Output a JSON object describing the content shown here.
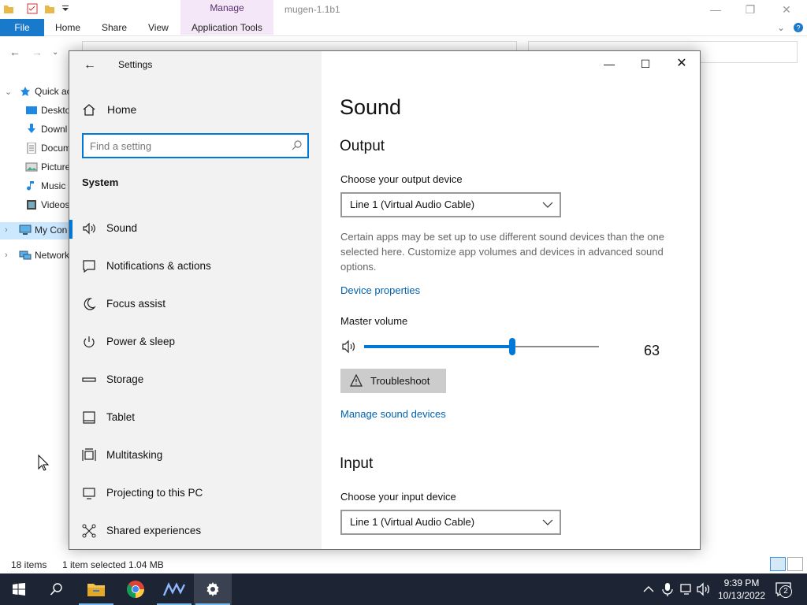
{
  "explorer": {
    "manage_tab": "Manage",
    "window_title": "mugen-1.1b1",
    "ribbon_tabs": {
      "file": "File",
      "home": "Home",
      "share": "Share",
      "view": "View",
      "app_tools": "Application Tools"
    },
    "tree": {
      "quick_access": "Quick ac",
      "desktop": "Deskto",
      "downloads": "Downl",
      "documents": "Docum",
      "pictures": "Picture",
      "music": "Music",
      "videos": "Videos",
      "my_computer": "My Con",
      "network": "Network"
    },
    "status": {
      "items": "18 items",
      "selected": "1 item selected  1.04 MB"
    }
  },
  "settings": {
    "title": "Settings",
    "home": "Home",
    "search_placeholder": "Find a setting",
    "category": "System",
    "nav": [
      {
        "label": "Sound",
        "icon": "speaker-icon",
        "active": true
      },
      {
        "label": "Notifications & actions",
        "icon": "notification-icon"
      },
      {
        "label": "Focus assist",
        "icon": "moon-icon"
      },
      {
        "label": "Power & sleep",
        "icon": "power-icon"
      },
      {
        "label": "Storage",
        "icon": "storage-icon"
      },
      {
        "label": "Tablet",
        "icon": "tablet-icon"
      },
      {
        "label": "Multitasking",
        "icon": "multitasking-icon"
      },
      {
        "label": "Projecting to this PC",
        "icon": "projector-icon"
      },
      {
        "label": "Shared experiences",
        "icon": "shared-icon"
      }
    ],
    "page": {
      "heading": "Sound",
      "output_heading": "Output",
      "output_device_label": "Choose your output device",
      "output_device_value": "Line 1 (Virtual Audio Cable)",
      "description": "Certain apps may be set up to use different sound devices than the one selected here. Customize app volumes and devices in advanced sound options.",
      "device_properties": "Device properties",
      "master_volume_label": "Master volume",
      "master_volume_value": "63",
      "master_volume_level": 0.63,
      "troubleshoot": "Troubleshoot",
      "manage_devices": "Manage sound devices",
      "input_heading": "Input",
      "input_device_label": "Choose your input device",
      "input_device_value": "Line 1 (Virtual Audio Cable)"
    }
  },
  "taskbar": {
    "time": "9:39 PM",
    "date": "10/13/2022",
    "notification_count": "2",
    "accent": "#0078d7"
  }
}
